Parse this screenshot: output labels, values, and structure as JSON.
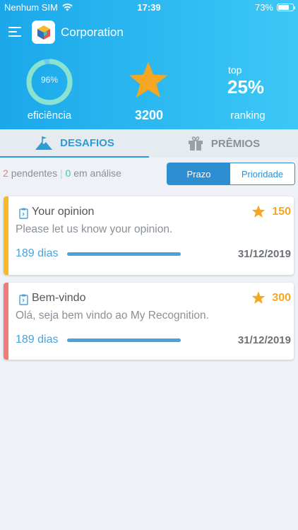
{
  "status_bar": {
    "carrier": "Nenhum SIM",
    "time": "17:39",
    "battery": "73%",
    "battery_level": 0.73
  },
  "header": {
    "title": "Corporation",
    "menu_icon": "hamburger-icon",
    "logo_icon": "cube-logo"
  },
  "stats": {
    "efficiency_value": "96%",
    "efficiency_fraction": 0.96,
    "efficiency_label": "eficiência",
    "points": "3200",
    "rank_top": "top",
    "rank_value": "25%",
    "rank_label": "ranking"
  },
  "tabs": [
    {
      "label": "DESAFIOS",
      "icon": "mountain-flag-icon",
      "active": true
    },
    {
      "label": "PRÊMIOS",
      "icon": "gift-icon",
      "active": false
    }
  ],
  "filters": {
    "pending_count": "2",
    "pending_label": "pendentes",
    "separator": "|",
    "review_count": "0",
    "review_label": "em análise",
    "sort_options": [
      "Prazo",
      "Prioridade"
    ],
    "sort_selected": "Prazo"
  },
  "challenges": [
    {
      "title": "Your opinion",
      "description": "Please let us know your opinion.",
      "points": "150",
      "days": "189 dias",
      "date": "31/12/2019",
      "accent": "#f7b928",
      "progress": 1.0
    },
    {
      "title": "Bem-vindo",
      "description": "Olá, seja bem vindo ao My Recognition.",
      "points": "300",
      "days": "189 dias",
      "date": "31/12/2019",
      "accent": "#f07b7b",
      "progress": 1.0
    }
  ],
  "colors": {
    "header_start": "#1ba8ea",
    "header_end": "#3cc8f6",
    "accent_blue": "#2d9bd6",
    "star": "#f5a623",
    "gauge": "#8be3cf"
  }
}
